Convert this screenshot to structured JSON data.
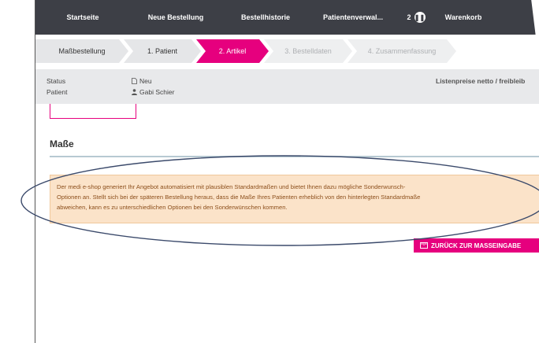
{
  "nav": {
    "home": "Startseite",
    "new_order": "Neue Bestellung",
    "history": "Bestellhistorie",
    "patients": "Patientenverwal...",
    "count": "2",
    "cart": "Warenkorb"
  },
  "steps": [
    {
      "label": "Maßbestellung"
    },
    {
      "label": "1. Patient"
    },
    {
      "label": "2. Artikel"
    },
    {
      "label": "3. Bestelldaten"
    },
    {
      "label": "4. Zusammenfassung"
    }
  ],
  "info": {
    "status_label": "Status",
    "status_value": "Neu",
    "patient_label": "Patient",
    "patient_value": "Gabi Schier",
    "price_note": "Listenpreise netto / freibleib"
  },
  "section": {
    "title": "Maße"
  },
  "notice": {
    "line1": "Der medi e-shop generiert Ihr Angebot automatisiert mit plausiblen Standardmaßen und bietet Ihnen dazu mögliche Sonderwunsch-",
    "line2": "Optionen an. Stellt sich bei der späteren Bestellung heraus, dass die Maße Ihres Patienten erheblich von den hinterlegten Standardmaße",
    "line3": "abweichen, kann es zu unterschiedlichen Optionen bei den Sonderwünschen kommen."
  },
  "back_button": {
    "label": "ZURÜCK ZUR MASSEINGABE"
  },
  "colors": {
    "nav_bg": "#3d3f46",
    "accent": "#e6007e",
    "notice_bg": "#fbe3c9",
    "notice_text": "#8c4f1c"
  }
}
